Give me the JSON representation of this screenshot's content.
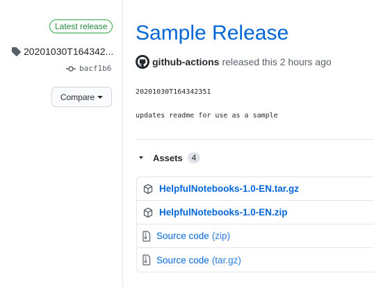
{
  "sidebar": {
    "latest_badge": "Latest release",
    "tag_name": "20201030T164342...",
    "commit": "bacf1b6",
    "compare_label": "Compare"
  },
  "release": {
    "title": "Sample Release",
    "author": "github-actions",
    "released_text": "released this 2 hours ago",
    "tag_line": "20201030T164342351",
    "body": "updates readme for use as a sample"
  },
  "assets": {
    "label": "Assets",
    "count": "4",
    "items": [
      {
        "name": "HelpfulNotebooks-1.0-EN.tar.gz",
        "icon": "package-icon"
      },
      {
        "name": "HelpfulNotebooks-1.0-EN.zip",
        "icon": "package-icon"
      },
      {
        "name": "Source code",
        "suffix": "(zip)",
        "icon": "file-zip-icon"
      },
      {
        "name": "Source code",
        "suffix": "(tar.gz)",
        "icon": "file-zip-icon"
      }
    ]
  },
  "colors": {
    "link": "#0366d6",
    "badge_green": "#28a745",
    "border": "#e1e4e8"
  }
}
